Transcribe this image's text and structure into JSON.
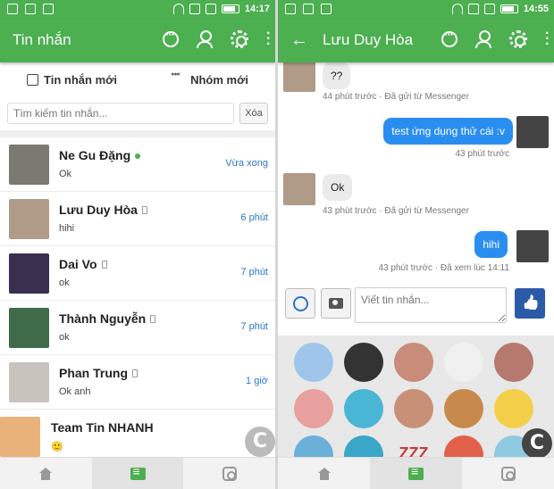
{
  "left": {
    "status_time": "14:17",
    "title": "Tin nhắn",
    "new_message_label": "Tin nhắn mới",
    "new_group_label": "Nhóm mới",
    "search_placeholder": "Tìm kiếm tin nhắn...",
    "clear_label": "Xóa",
    "conversations": [
      {
        "name": "Ne Gu Đặng",
        "preview": "Ok",
        "time": "Vừa xong",
        "status": "online",
        "avatar_color": "#7a7a70"
      },
      {
        "name": "Lưu Duy Hòa",
        "preview": "hihi",
        "time": "6 phút",
        "status": "mobile",
        "avatar_color": "#b09a88"
      },
      {
        "name": "Dai Vo",
        "preview": "ok",
        "time": "7 phút",
        "status": "mobile",
        "avatar_color": "#3a2f4f"
      },
      {
        "name": "Thành Nguyễn",
        "preview": "ok",
        "time": "7 phút",
        "status": "mobile",
        "avatar_color": "#3f6b4a"
      },
      {
        "name": "Phan Trung",
        "preview": "Ok anh",
        "time": "1 giờ",
        "status": "mobile",
        "avatar_color": "#c9c3bd"
      },
      {
        "name": "Team Tin NHANH",
        "preview": "🙂",
        "time": "T7",
        "status": "",
        "avatar_color": "#e9b27a"
      }
    ]
  },
  "right": {
    "status_time": "14:55",
    "title": "Lưu Duy Hòa",
    "messages": [
      {
        "direction": "in",
        "text": "??",
        "meta": "44 phút trước · Đã gửi từ Messenger"
      },
      {
        "direction": "out",
        "text": "test ứng dụng thử cái :v",
        "meta": "43 phút trước"
      },
      {
        "direction": "in",
        "text": "Ok",
        "meta": "43 phút trước · Đã gửi từ Messenger"
      },
      {
        "direction": "out",
        "text": "hihi",
        "meta": "43 phút trước · Đã xem lúc 14:11"
      }
    ],
    "composer_placeholder": "Viết tin nhắn...",
    "sticker_colors": [
      "#9fc6ea",
      "#333333",
      "#c98b7a",
      "#f0f0f0",
      "#b57a6d",
      "#e9a0a0",
      "#49b6d6",
      "#c99078",
      "#c88a4c",
      "#f4d04a",
      "#6bb0d8",
      "#3aa7c8",
      "#c43a3a",
      "#e2604a",
      "#8fcbe0"
    ],
    "sticker_text": "ZZZ"
  },
  "colors": {
    "brand": "#4caf50",
    "accent": "#2a8ef0",
    "link": "#2a76c8"
  },
  "icons": [
    "search-icon",
    "user-add-icon",
    "gear-icon",
    "more-icon",
    "home-icon",
    "chat-icon",
    "instagram-icon"
  ]
}
